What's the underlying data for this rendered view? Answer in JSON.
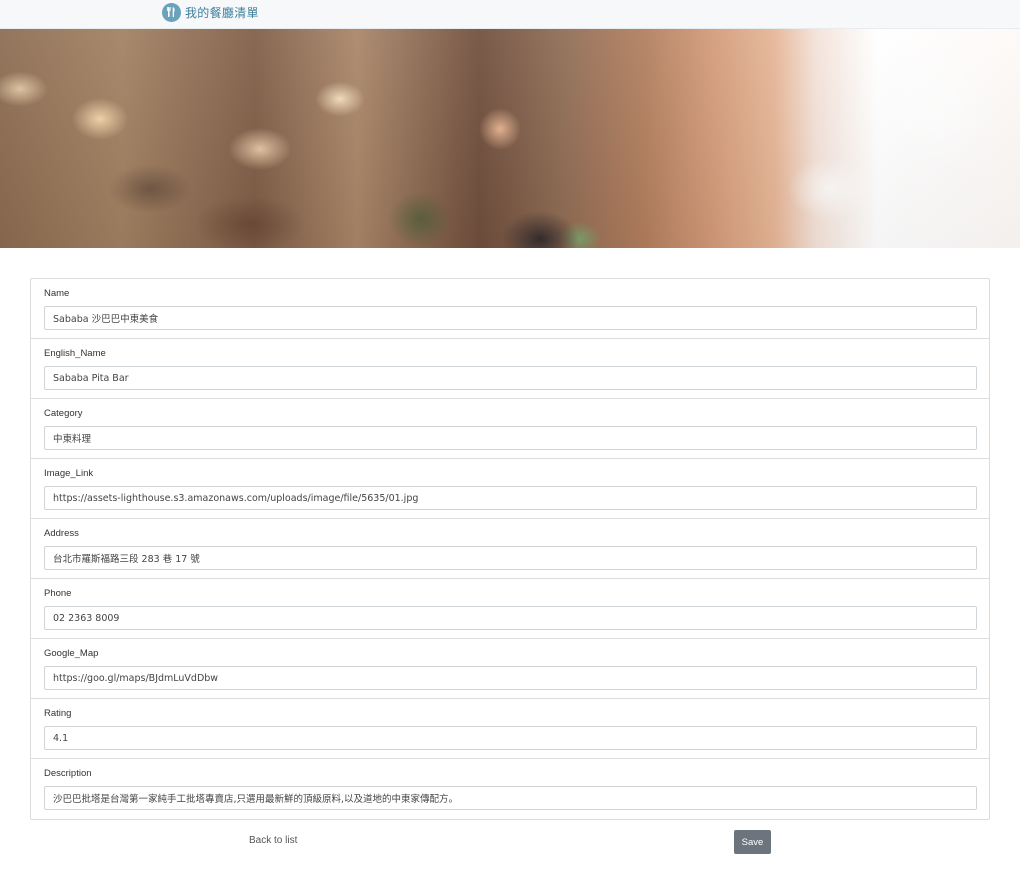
{
  "navbar": {
    "brand_icon": "utensils-icon",
    "brand_title": "我的餐廳清單",
    "brand_color": "#3e7f9c"
  },
  "banner": {
    "description_icon": "restaurant-banner-image"
  },
  "form": {
    "fields": [
      {
        "label": "Name",
        "value": "Sababa 沙巴巴中東美食"
      },
      {
        "label": "English_Name",
        "value": "Sababa Pita Bar"
      },
      {
        "label": "Category",
        "value": "中東料理"
      },
      {
        "label": "Image_Link",
        "value": "https://assets-lighthouse.s3.amazonaws.com/uploads/image/file/5635/01.jpg"
      },
      {
        "label": "Address",
        "value": "台北市羅斯福路三段 283 巷 17 號"
      },
      {
        "label": "Phone",
        "value": "02 2363 8009"
      },
      {
        "label": "Google_Map",
        "value": "https://goo.gl/maps/BJdmLuVdDbw"
      },
      {
        "label": "Rating",
        "value": "4.1"
      },
      {
        "label": "Description",
        "value": "沙巴巴批塔是台灣第一家純手工批塔專賣店,只選用最新鮮的頂級原料,以及道地的中東家傳配方。"
      }
    ]
  },
  "actions": {
    "back_label": "Back to list",
    "save_label": "Save",
    "save_color": "#6c757d"
  }
}
